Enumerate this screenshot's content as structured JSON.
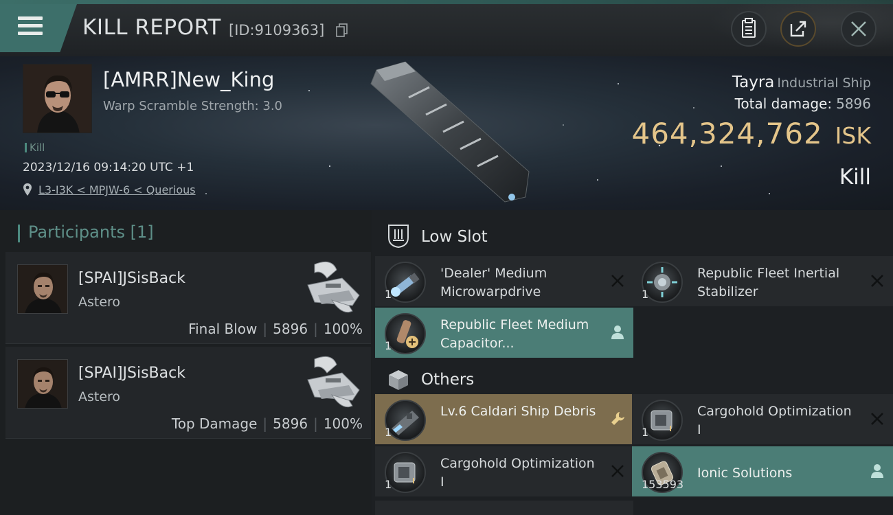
{
  "header": {
    "title": "KILL REPORT",
    "report_id": "[ID:9109363]",
    "icons": {
      "menu": "hamburger-menu-icon",
      "copy": "copy-icon",
      "clipboard": "clipboard-icon",
      "share": "share-icon",
      "close": "close-icon"
    }
  },
  "victim": {
    "name": "[AMRR]New_King",
    "warp": "Warp Scramble Strength: 3.0",
    "kill_tag": "Kill",
    "datetime": "2023/12/16 09:14:20 UTC +1",
    "location": "L3-I3K < MPJW-6 < Querious",
    "ship_name": "Tayra",
    "ship_class": "Industrial Ship",
    "total_damage_label": "Total damage:",
    "total_damage": "5896",
    "isk_value": "464,324,762",
    "isk_unit": "ISK",
    "result": "Kill"
  },
  "participants": {
    "title": "Participants",
    "count": "[1]",
    "list": [
      {
        "name": "[SPAI]JSisBack",
        "ship": "Astero",
        "role": "Final Blow",
        "damage": "5896",
        "percent": "100%"
      },
      {
        "name": "[SPAI]JSisBack",
        "ship": "Astero",
        "role": "Top Damage",
        "damage": "5896",
        "percent": "100%"
      }
    ]
  },
  "sections": {
    "low_slot": "Low Slot",
    "others": "Others"
  },
  "items": [
    {
      "name": "'Dealer' Medium Microwarpdrive",
      "qty": "1",
      "status": "destroyed",
      "bg": "dark"
    },
    {
      "name": "Republic Fleet Inertial Stabilizer",
      "qty": "1",
      "status": "destroyed",
      "bg": "dark"
    },
    {
      "name": "Republic Fleet Medium Capacitor...",
      "qty": "1",
      "status": "dropped",
      "bg": "green"
    },
    {
      "name": "Lv.6 Caldari Ship Debris",
      "qty": "1",
      "status": "salvage",
      "bg": "gold"
    },
    {
      "name": "Cargohold Optimization I",
      "qty": "1",
      "status": "destroyed",
      "bg": "dark"
    },
    {
      "name": "Cargohold Optimization I",
      "qty": "1",
      "status": "destroyed",
      "bg": "dark"
    },
    {
      "name": "Ionic Solutions",
      "qty": "153593",
      "status": "dropped",
      "bg": "green"
    }
  ],
  "colors": {
    "accent": "#4b7d76",
    "isk": "#e4c58a",
    "gold_item": "#7d6d4e"
  }
}
